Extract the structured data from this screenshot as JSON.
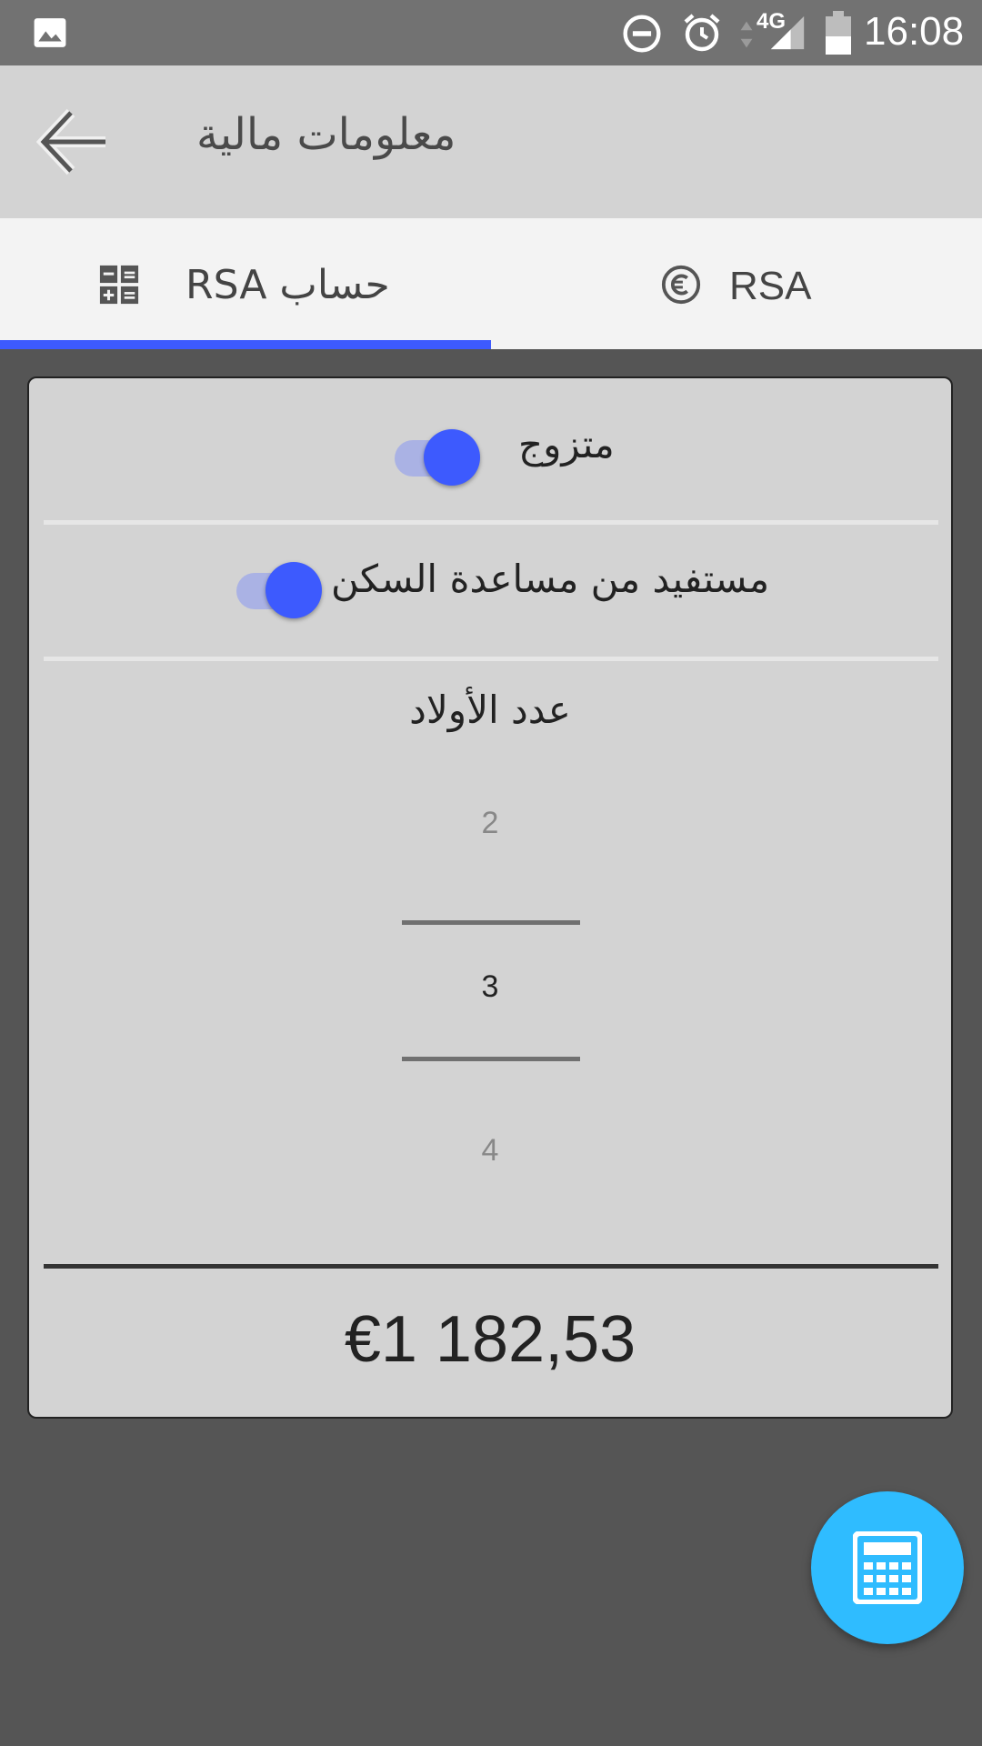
{
  "status_bar": {
    "time": "16:08",
    "network": "4G",
    "icons": [
      "image-icon",
      "do-not-disturb-icon",
      "alarm-icon",
      "data-arrows-icon",
      "signal-icon",
      "battery-icon"
    ]
  },
  "toolbar": {
    "title": "معلومات مالية",
    "back_icon": "arrow-back-icon"
  },
  "tabs": [
    {
      "label": "حساب  RSA",
      "icon": "calculator-grid-icon",
      "selected": true
    },
    {
      "label": "RSA",
      "icon": "euro-circle-icon",
      "selected": false
    }
  ],
  "form": {
    "married": {
      "label": "متزوج",
      "checked": true
    },
    "housing_aid": {
      "label": "مستفيد  من  مساعدة  السكن",
      "checked": true
    },
    "children": {
      "label": "عدد  الأولاد",
      "prev": "2",
      "selected": "3",
      "next": "4"
    },
    "result": "€1 182,53"
  },
  "fab": {
    "icon": "calculator-icon"
  },
  "colors": {
    "accent": "#3d5afe",
    "toggle_track": "#aab2e4",
    "fab": "#2fbcff",
    "toolbar": "#d3d3d3",
    "background": "#555555"
  }
}
